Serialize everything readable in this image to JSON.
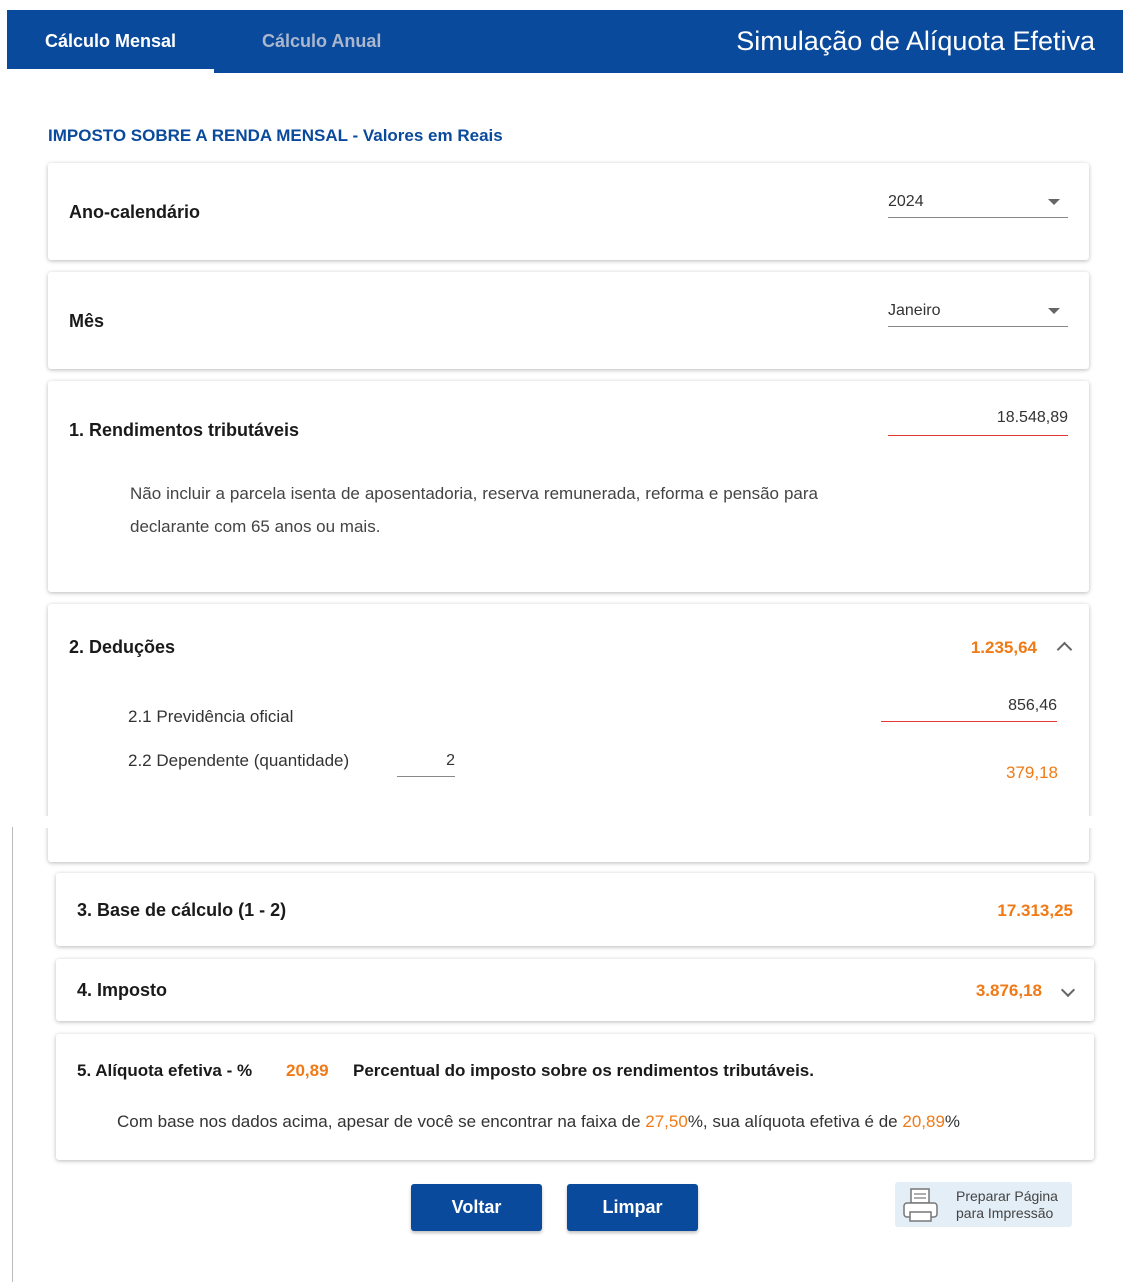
{
  "header": {
    "tab_monthly": "Cálculo Mensal",
    "tab_annual": "Cálculo Anual",
    "title": "Simulação de Alíquota Efetiva"
  },
  "section_heading": "IMPOSTO SOBRE A RENDA MENSAL - Valores em Reais",
  "year": {
    "label": "Ano-calendário",
    "value": "2024"
  },
  "month": {
    "label": "Mês",
    "value": "Janeiro"
  },
  "income": {
    "label": "1. Rendimentos tributáveis",
    "value": "18.548,89",
    "note": "Não incluir a parcela isenta de aposentadoria, reserva remunerada, reforma e pensão para declarante com 65 anos ou mais."
  },
  "deductions": {
    "label": "2. Deduções",
    "total": "1.235,64",
    "social_security_label": "2.1 Previdência oficial",
    "social_security_value": "856,46",
    "dependents_label": "2.2 Dependente (quantidade)",
    "dependents_qty": "2",
    "dependents_value": "379,18"
  },
  "base": {
    "label": "3. Base de cálculo (1 - 2)",
    "value": "17.313,25"
  },
  "tax": {
    "label": "4. Imposto",
    "value": "3.876,18"
  },
  "effective": {
    "label": "5. Alíquota efetiva - %",
    "value": "20,89",
    "description": "Percentual do imposto sobre os rendimentos tributáveis.",
    "sentence_part1": "Com base nos dados acima, apesar de você se encontrar na faixa de ",
    "bracket": "27,50",
    "sentence_part2": "%, sua alíquota efetiva é de ",
    "rate": "20,89",
    "sentence_part3": "%"
  },
  "buttons": {
    "back": "Voltar",
    "clear": "Limpar"
  },
  "print": {
    "line1": "Preparar Página",
    "line2": "para Impressão"
  },
  "colors": {
    "brand_blue": "#0a4a9c",
    "accent_orange": "#f07a16",
    "error_red": "#e53935"
  },
  "icons": [
    "caret-down-icon",
    "chevron-up-icon",
    "chevron-down-icon",
    "printer-icon"
  ]
}
